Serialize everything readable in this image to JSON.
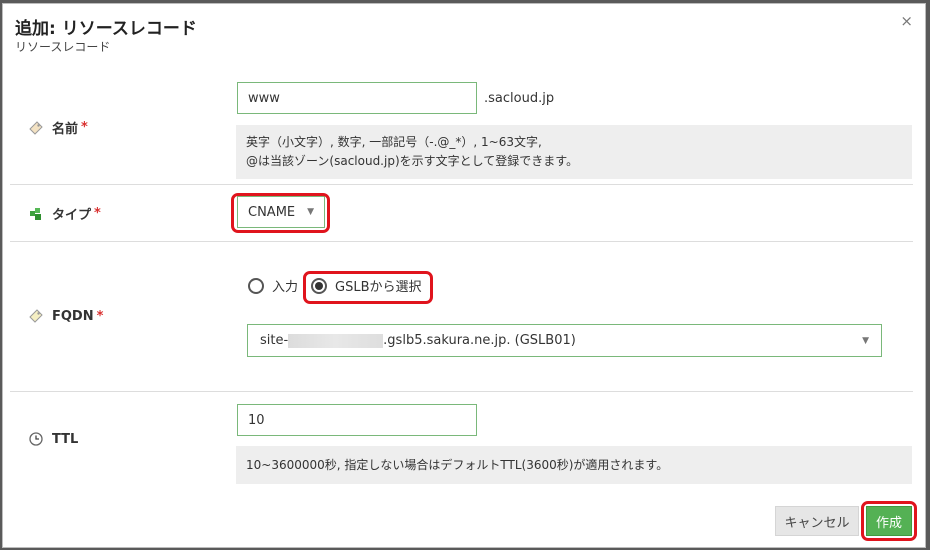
{
  "dialog": {
    "title": "追加: リソースレコード",
    "subtitle": "リソースレコード",
    "close": "×"
  },
  "name_field": {
    "label": "名前",
    "required": "*",
    "value": "www",
    "suffix": ".sacloud.jp",
    "help_line1": "英字（小文字）, 数字, 一部記号（-.@_*）, 1~63文字,",
    "help_line2": "@は当該ゾーン(sacloud.jp)を示す文字として登録できます。"
  },
  "type_field": {
    "label": "タイプ",
    "required": "*",
    "selected": "CNAME"
  },
  "fqdn_field": {
    "label": "FQDN",
    "required": "*",
    "option_input": "入力",
    "option_gslb": "GSLBから選択",
    "selected_option": "GSLBから選択",
    "select_prefix": "site-",
    "select_suffix": ".gslb5.sakura.ne.jp. (GSLB01)"
  },
  "ttl_field": {
    "label": "TTL",
    "value": "10",
    "help": "10~3600000秒, 指定しない場合はデフォルトTTL(3600秒)が適用されます。"
  },
  "buttons": {
    "cancel": "キャンセル",
    "create": "作成"
  },
  "colors": {
    "highlight": "#e0141d",
    "accent_green": "#54b154",
    "required": "#d9302f"
  }
}
